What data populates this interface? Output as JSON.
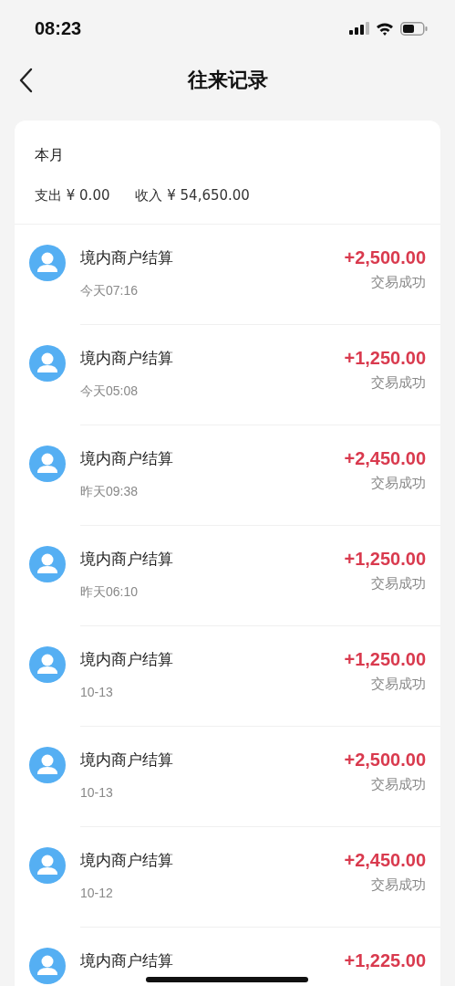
{
  "status_bar": {
    "time": "08:23"
  },
  "nav": {
    "title": "往来记录"
  },
  "summary": {
    "period": "本月",
    "expense": "支出 ¥ 0.00",
    "income": "收入 ¥ 54,650.00"
  },
  "records": [
    {
      "title": "境内商户结算",
      "time": "今天07:16",
      "amount": "+2,500.00",
      "status": "交易成功"
    },
    {
      "title": "境内商户结算",
      "time": "今天05:08",
      "amount": "+1,250.00",
      "status": "交易成功"
    },
    {
      "title": "境内商户结算",
      "time": "昨天09:38",
      "amount": "+2,450.00",
      "status": "交易成功"
    },
    {
      "title": "境内商户结算",
      "time": "昨天06:10",
      "amount": "+1,250.00",
      "status": "交易成功"
    },
    {
      "title": "境内商户结算",
      "time": "10-13",
      "amount": "+1,250.00",
      "status": "交易成功"
    },
    {
      "title": "境内商户结算",
      "time": "10-13",
      "amount": "+2,500.00",
      "status": "交易成功"
    },
    {
      "title": "境内商户结算",
      "time": "10-12",
      "amount": "+2,450.00",
      "status": "交易成功"
    },
    {
      "title": "境内商户结算",
      "amount": "+1,225.00"
    }
  ]
}
